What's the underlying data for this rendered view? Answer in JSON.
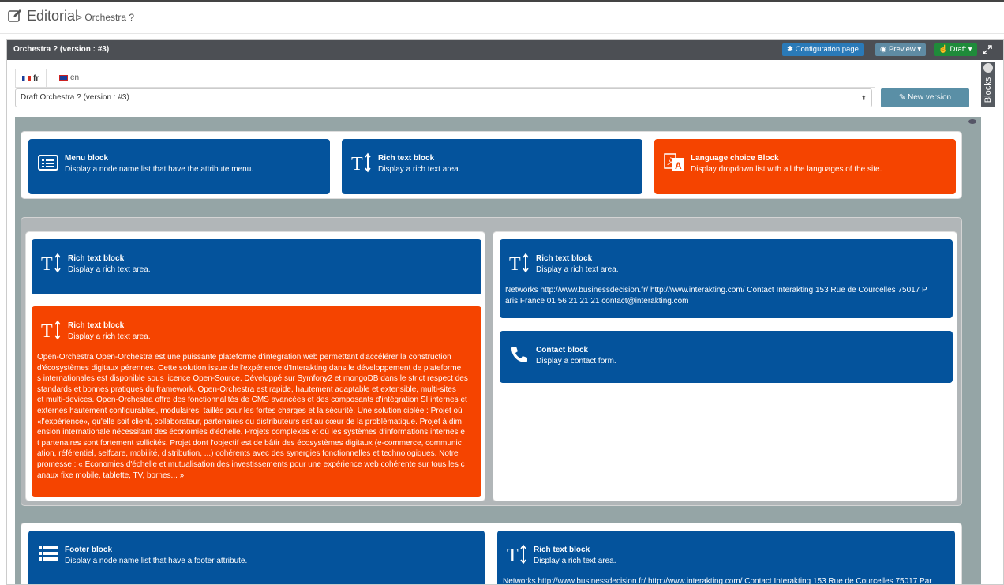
{
  "header": {
    "title": "Editorial",
    "breadcrumb": "> Orchestra ?"
  },
  "panel": {
    "title": "Orchestra ? (version : #3)",
    "config_label": "Configuration page",
    "preview_label": "Preview",
    "draft_label": "Draft"
  },
  "tabs": [
    {
      "label": "fr",
      "active": true
    },
    {
      "label": "en",
      "active": false
    }
  ],
  "version_select": {
    "value": "Draft Orchestra ? (version : #3)"
  },
  "new_version_label": "New version",
  "blocks_panel_label": "Blocks",
  "colors": {
    "blue_block": "#04539c",
    "orange_block": "#f54400",
    "canvas": "#95a5a6",
    "header_bar": "#4c4f54"
  },
  "blocks": {
    "menu": {
      "icon": "list-icon",
      "title": "Menu block",
      "desc": "Display a node name list that have the attribute menu."
    },
    "richtext_top": {
      "icon": "text-size-icon",
      "title": "Rich text block",
      "desc": "Display a rich text area."
    },
    "language": {
      "icon": "translate-icon",
      "title": "Language choice Block",
      "desc": "Display dropdown list with all the languages of the site."
    },
    "richtext_left": {
      "icon": "text-size-icon",
      "title": "Rich text block",
      "desc": "Display a rich text area."
    },
    "richtext_orange": {
      "icon": "text-size-icon",
      "title": "Rich text block",
      "desc": "Display a rich text area.",
      "lines": [
        "Open-Orchestra Open-Orchestra est une puissante plateforme d'intégration web permettant d'accélérer la construction",
        "d'écosystèmes digitaux pérennes. Cette solution issue de l'expérience d'Interakting dans le développement de plateforme",
        "s internationales est disponible sous licence Open-Source. Développé sur Symfony2 et mongoDB dans le strict respect des",
        "standards et bonnes pratiques du framework. Open-Orchestra est rapide, hautement adaptable et extensible, multi-sites",
        "et multi-devices. Open-Orchestra offre des fonctionnalités de CMS avancées et des composants d'intégration SI internes et",
        "externes hautement configurables, modulaires, taillés pour les fortes charges et la sécurité. Une solution ciblée : Projet où",
        "«l'expérience», qu'elle soit client, collaborateur, partenaires ou distributeurs est au cœur de la problématique. Projet à dim",
        "ension internationale nécessitant des économies d'échelle. Projets complexes et où les systèmes d'informations internes e",
        "t partenaires sont fortement sollicités. Projet dont l'objectif est de bâtir des écosystèmes digitaux (e-commerce, communic",
        "ation, référentiel, selfcare, mobilité, distribution, ...) cohérents avec des synergies fonctionnelles et technologiques. Notre",
        "promesse : « Economies d'échelle et mutualisation des investissements pour une expérience web cohérente sur tous les c",
        "anaux fixe mobile, tablette, TV, bornes... »"
      ]
    },
    "richtext_right": {
      "icon": "text-size-icon",
      "title": "Rich text block",
      "desc": "Display a rich text area.",
      "lines": [
        "Networks http://www.businessdecision.fr/ http://www.interakting.com/ Contact Interakting 153 Rue de Courcelles 75017 P",
        "aris France 01 56 21 21 21 contact@interakting.com"
      ]
    },
    "contact": {
      "icon": "phone-icon",
      "title": "Contact block",
      "desc": "Display a contact form."
    },
    "footer": {
      "icon": "list-icon",
      "title": "Footer block",
      "desc": "Display a node name list that have a footer attribute."
    },
    "richtext_bottom": {
      "icon": "text-size-icon",
      "title": "Rich text block",
      "desc": "Display a rich text area.",
      "lines": [
        "Networks http://www.businessdecision.fr/ http://www.interakting.com/ Contact Interakting 153 Rue de Courcelles 75017 Par"
      ]
    }
  }
}
